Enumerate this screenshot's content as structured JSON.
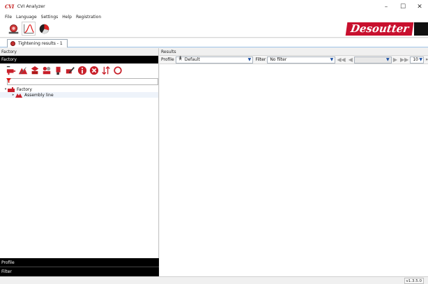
{
  "window": {
    "logo_text": "CVI",
    "title": "CVI Analyzer",
    "minimize": "–",
    "maximize": "☐",
    "close": "✕"
  },
  "menu": {
    "items": [
      "File",
      "Language",
      "Settings",
      "Help",
      "Registration"
    ]
  },
  "toolbar": {
    "buttons": [
      "tightening-results-icon",
      "curves-icon",
      "statistics-icon"
    ],
    "brand": "Desoutter"
  },
  "tabs": [
    {
      "label": "Tightening results - 1",
      "icon": "tightening-results-icon"
    }
  ],
  "factory_panel": {
    "header": "Factory",
    "subheader": "Factory",
    "tools": [
      "add-controller-icon",
      "add-assembly-line-icon",
      "add-station-icon",
      "add-group-icon",
      "add-tool-icon",
      "edit-icon",
      "info-icon",
      "delete-icon",
      "sort-icon",
      "refresh-icon"
    ],
    "filter_value": "",
    "tree": [
      {
        "label": "Factory",
        "expanded": true,
        "level": 0
      },
      {
        "label": "Assembly line",
        "expanded": false,
        "level": 1
      }
    ],
    "profile_header": "Profile",
    "filter_header": "Filter"
  },
  "results_panel": {
    "header": "Results",
    "profile_label": "Profile",
    "profile_value": "Default",
    "filter_label": "Filter",
    "filter_value": "No filter",
    "page_size": "10",
    "more": "»"
  },
  "status": {
    "version": "v1.3.5.0"
  }
}
